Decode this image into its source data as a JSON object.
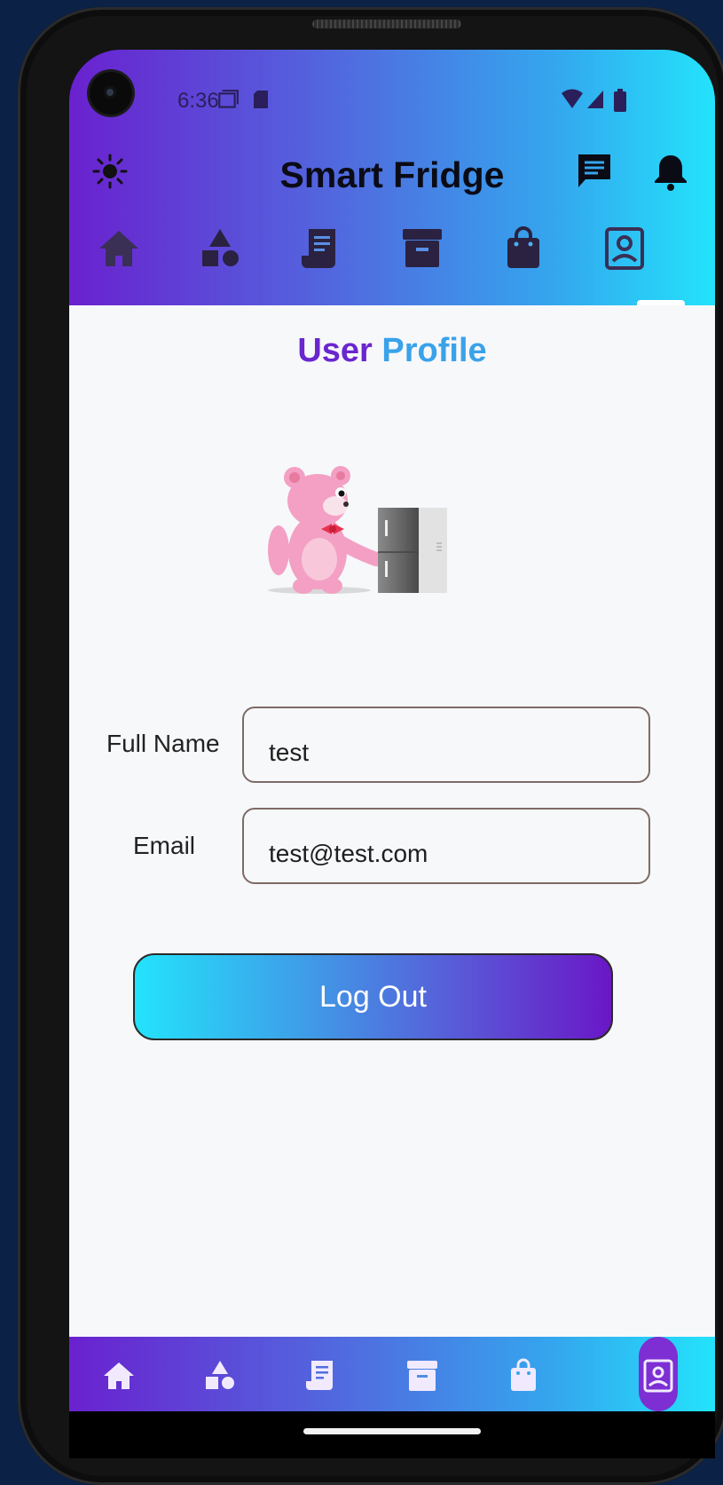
{
  "status_bar": {
    "time": "6:36"
  },
  "app": {
    "title": "Smart Fridge"
  },
  "page": {
    "title_part1": "User",
    "title_part2": "Profile"
  },
  "form": {
    "full_name_label": "Full Name",
    "full_name_value": "test",
    "email_label": "Email",
    "email_value": "test@test.com"
  },
  "logout_label": "Log Out",
  "tabs": [
    {
      "icon": "home-icon"
    },
    {
      "icon": "category-shapes-icon"
    },
    {
      "icon": "receipt-icon"
    },
    {
      "icon": "storage-box-icon"
    },
    {
      "icon": "shopping-bag-icon"
    },
    {
      "icon": "profile-portrait-icon",
      "active": true
    }
  ],
  "colors": {
    "gradient_start": "#6a21cf",
    "gradient_end": "#23e3fb",
    "title_purple": "#6a26cf",
    "title_blue": "#3aa2ea"
  }
}
